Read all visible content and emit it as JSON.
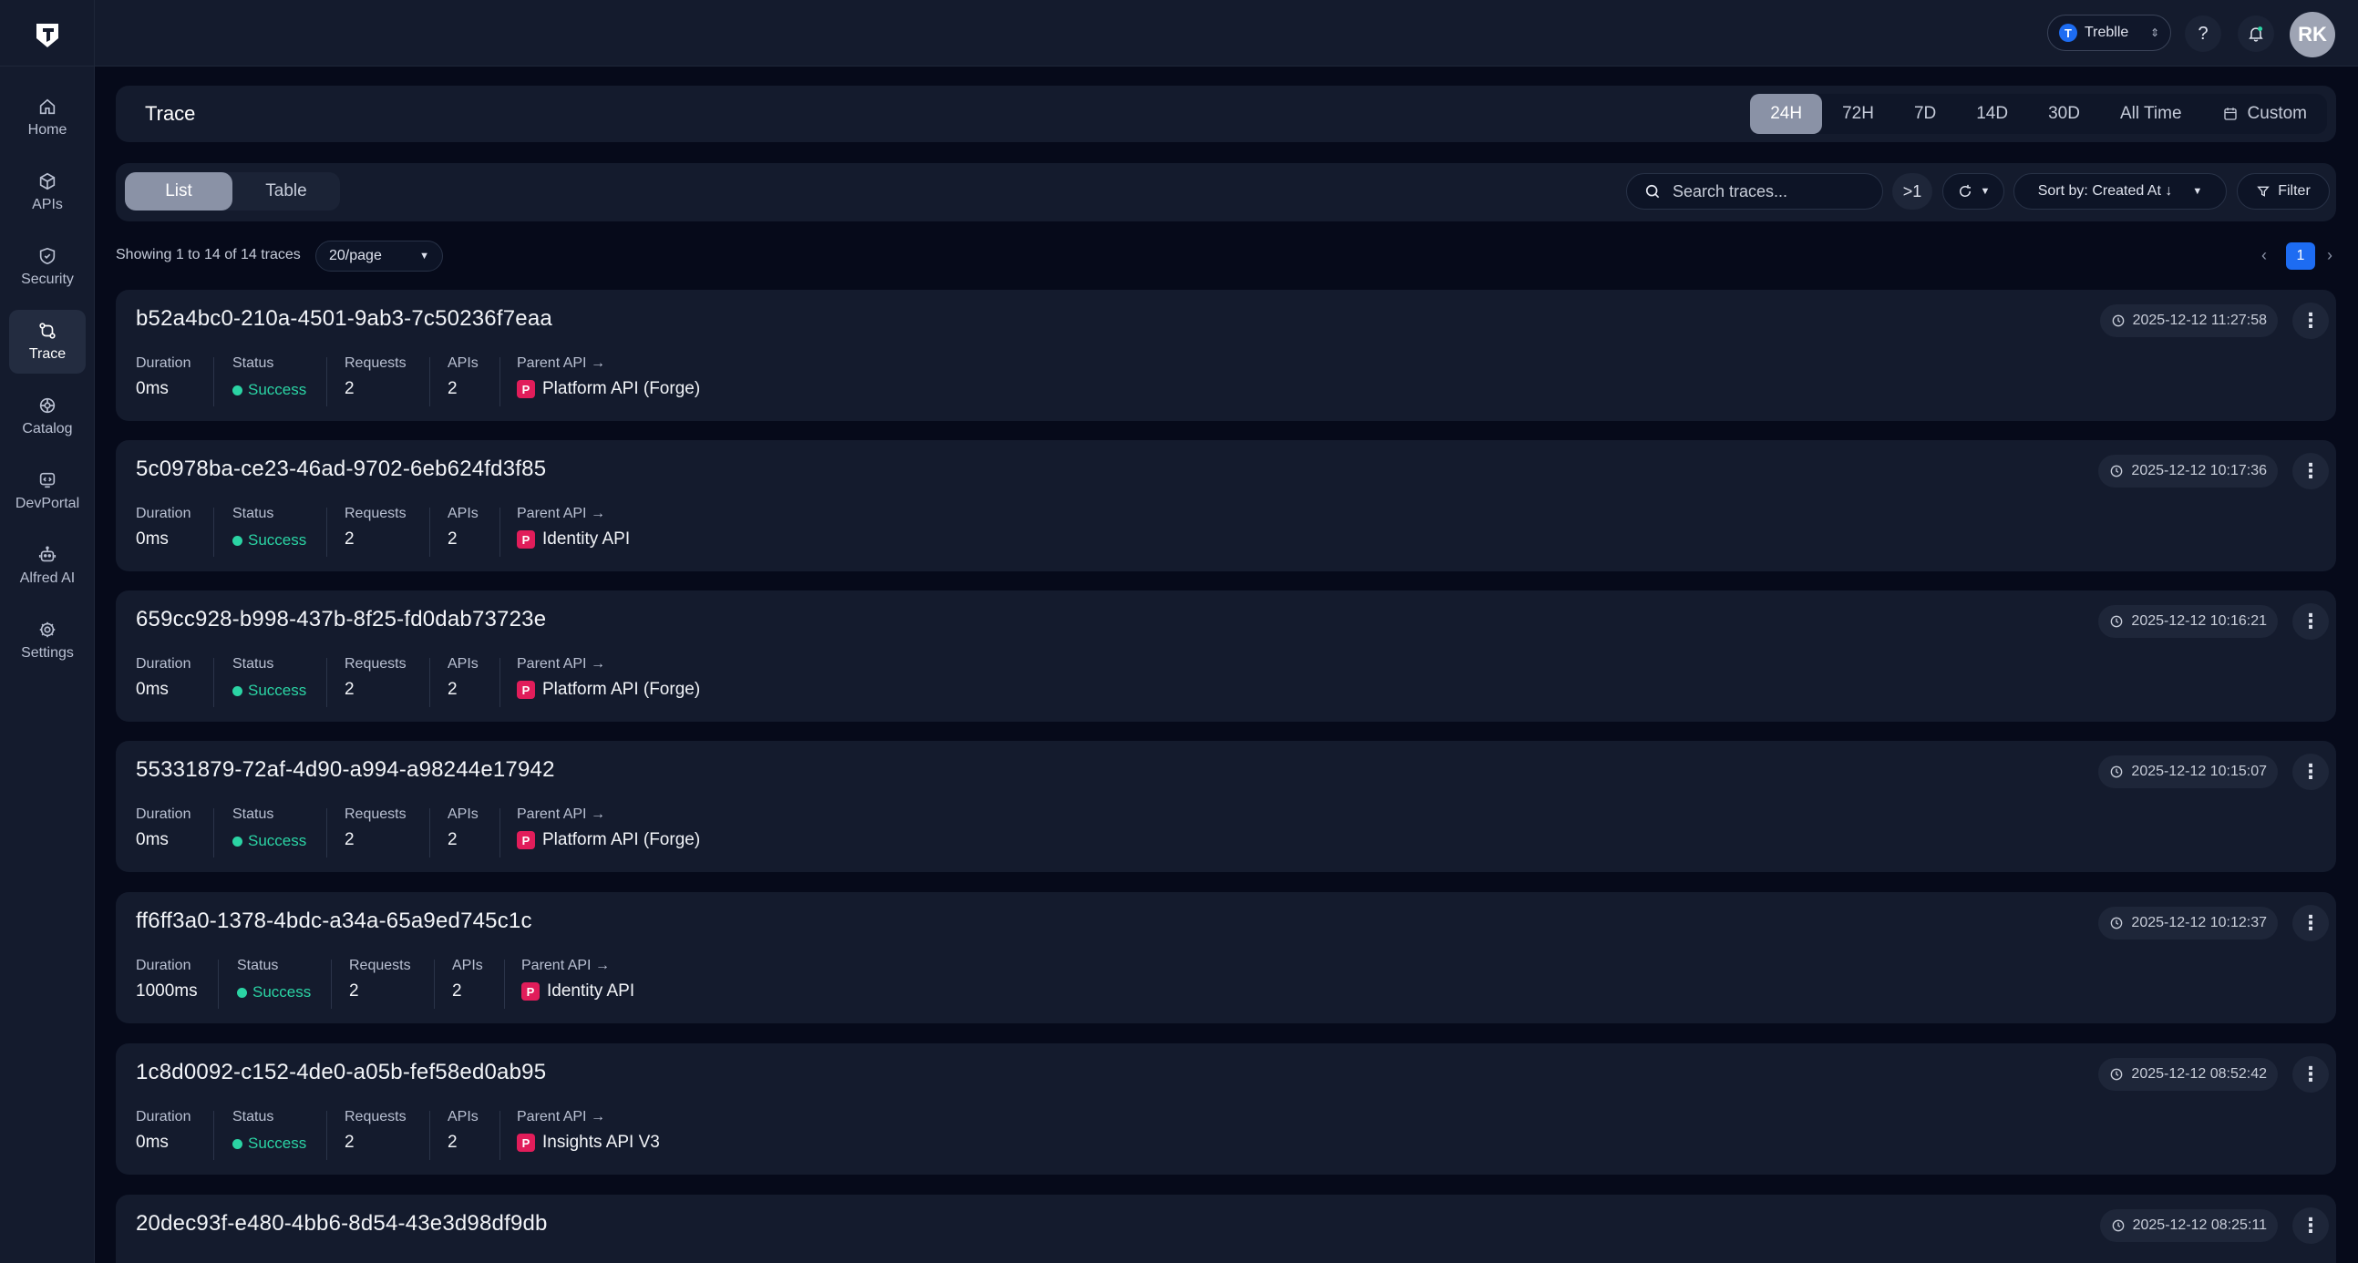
{
  "brand": {
    "org_name": "Treblle",
    "org_initial": "T",
    "user_initials": "RK",
    "accent": "#1d6cf2"
  },
  "sidebar": {
    "items": [
      {
        "label": "Home",
        "icon": "home-icon"
      },
      {
        "label": "APIs",
        "icon": "cube-icon"
      },
      {
        "label": "Security",
        "icon": "shield-icon"
      },
      {
        "label": "Trace",
        "icon": "trace-icon",
        "active": true
      },
      {
        "label": "Catalog",
        "icon": "catalog-icon"
      },
      {
        "label": "DevPortal",
        "icon": "devportal-icon"
      },
      {
        "label": "Alfred AI",
        "icon": "robot-icon"
      },
      {
        "label": "Settings",
        "icon": "gear-icon"
      }
    ]
  },
  "header": {
    "title": "Trace",
    "ranges": [
      "24H",
      "72H",
      "7D",
      "14D",
      "30D",
      "All Time"
    ],
    "active_range": "24H",
    "custom_label": "Custom"
  },
  "toolbar": {
    "views": [
      "List",
      "Table"
    ],
    "active_view": "List",
    "search_placeholder": "Search traces...",
    "depth_label": ">1",
    "sort_label": "Sort by: Created At ↓",
    "filter_label": "Filter"
  },
  "pagination": {
    "showing": "Showing 1 to 14 of 14 traces",
    "per_page": "20/page",
    "current_page": "1"
  },
  "labels": {
    "duration": "Duration",
    "status": "Status",
    "requests": "Requests",
    "apis": "APIs",
    "parent_api": "Parent API →",
    "parent_badge": "P"
  },
  "traces": [
    {
      "id": "b52a4bc0-210a-4501-9ab3-7c50236f7eaa",
      "timestamp": "2025-12-12 11:27:58",
      "duration": "0ms",
      "status": "Success",
      "requests": "2",
      "apis": "2",
      "parent_api": "Platform API (Forge)"
    },
    {
      "id": "5c0978ba-ce23-46ad-9702-6eb624fd3f85",
      "timestamp": "2025-12-12 10:17:36",
      "duration": "0ms",
      "status": "Success",
      "requests": "2",
      "apis": "2",
      "parent_api": "Identity API"
    },
    {
      "id": "659cc928-b998-437b-8f25-fd0dab73723e",
      "timestamp": "2025-12-12 10:16:21",
      "duration": "0ms",
      "status": "Success",
      "requests": "2",
      "apis": "2",
      "parent_api": "Platform API (Forge)"
    },
    {
      "id": "55331879-72af-4d90-a994-a98244e17942",
      "timestamp": "2025-12-12 10:15:07",
      "duration": "0ms",
      "status": "Success",
      "requests": "2",
      "apis": "2",
      "parent_api": "Platform API (Forge)"
    },
    {
      "id": "ff6ff3a0-1378-4bdc-a34a-65a9ed745c1c",
      "timestamp": "2025-12-12 10:12:37",
      "duration": "1000ms",
      "status": "Success",
      "requests": "2",
      "apis": "2",
      "parent_api": "Identity API"
    },
    {
      "id": "1c8d0092-c152-4de0-a05b-fef58ed0ab95",
      "timestamp": "2025-12-12 08:52:42",
      "duration": "0ms",
      "status": "Success",
      "requests": "2",
      "apis": "2",
      "parent_api": "Insights API V3"
    },
    {
      "id": "20dec93f-e480-4bb6-8d54-43e3d98df9db",
      "timestamp": "2025-12-12 08:25:11"
    }
  ]
}
